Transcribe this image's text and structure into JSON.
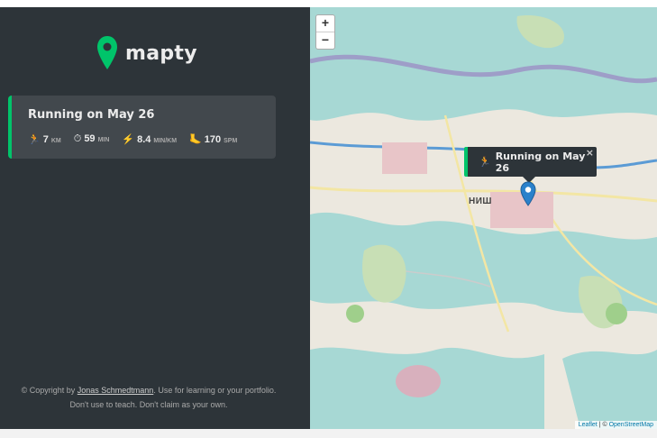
{
  "app": {
    "name": "mapty"
  },
  "workout": {
    "title": "Running on May 26",
    "details": [
      {
        "icon": "🏃",
        "value": "7",
        "unit": "km"
      },
      {
        "icon": "⏱",
        "value": "59",
        "unit": "min"
      },
      {
        "icon": "⚡",
        "value": "8.4",
        "unit": "min/km"
      },
      {
        "icon": "🦶",
        "value": "170",
        "unit": "spm"
      }
    ]
  },
  "copyright": {
    "prefix": "© Copyright by ",
    "author": "Jonas Schmedtmann",
    "suffix": ". Use for learning or your portfolio. Don't use to teach. Don't claim as your own."
  },
  "map": {
    "zoom_in": "+",
    "zoom_out": "−",
    "popup_icon": "🏃",
    "popup_text": "Running on May 26",
    "popup_close": "×",
    "city_label": "НИШ",
    "attribution_leaflet": "Leaflet",
    "attribution_sep": " | © ",
    "attribution_osm": "OpenStreetMap"
  },
  "colors": {
    "accent": "#00c46a",
    "sidebar": "#2d3439",
    "card": "#42484d",
    "marker": "#2a81cb"
  },
  "icons": {
    "logo": "map-pin-logo-icon",
    "marker": "map-marker-icon"
  }
}
